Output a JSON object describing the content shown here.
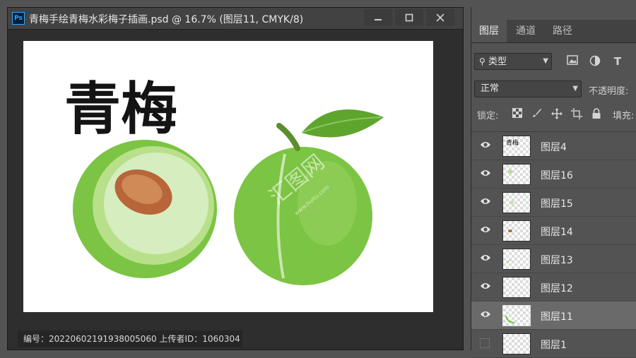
{
  "document": {
    "title": "青梅手绘青梅水彩梅子插画.psd @ 16.7% (图层11, CMYK/8)",
    "app_icon": "Ps",
    "window_buttons": {
      "minimize": "minimize-icon",
      "maximize": "maximize-icon",
      "close": "close-icon"
    }
  },
  "canvas": {
    "heading": "青梅",
    "watermark": "汇图网",
    "watermark_url": "www.huitu.com"
  },
  "info_bar": {
    "text": "编号：20220602191938005060 上传者ID：1060304"
  },
  "panel": {
    "tabs": [
      {
        "label": "图层",
        "active": true
      },
      {
        "label": "通道",
        "active": false
      },
      {
        "label": "路径",
        "active": false
      }
    ],
    "filter": {
      "label": "类型",
      "icons": [
        "image-filter-icon",
        "adjustment-filter-icon",
        "type-filter-icon"
      ],
      "type_glyph": "T"
    },
    "blend_mode": "正常",
    "opacity_label": "不透明度:",
    "lock_label": "锁定:",
    "lock_icons": [
      "lock-transparent-icon",
      "lock-brush-icon",
      "lock-move-icon",
      "lock-artboard-icon",
      "lock-all-icon"
    ],
    "fill_label": "填充:",
    "layers": [
      {
        "name": "图层4",
        "visible": true,
        "selected": false
      },
      {
        "name": "图层16",
        "visible": true,
        "selected": false
      },
      {
        "name": "图层15",
        "visible": true,
        "selected": false
      },
      {
        "name": "图层14",
        "visible": true,
        "selected": false
      },
      {
        "name": "图层13",
        "visible": true,
        "selected": false
      },
      {
        "name": "图层12",
        "visible": true,
        "selected": false
      },
      {
        "name": "图层11",
        "visible": true,
        "selected": true
      },
      {
        "name": "图层1",
        "visible": false,
        "selected": false
      }
    ]
  },
  "colors": {
    "plum_green": "#7cc443",
    "plum_light": "#b8e08a",
    "pit_brown": "#b8653a",
    "ps_blue": "#31a8ff"
  }
}
